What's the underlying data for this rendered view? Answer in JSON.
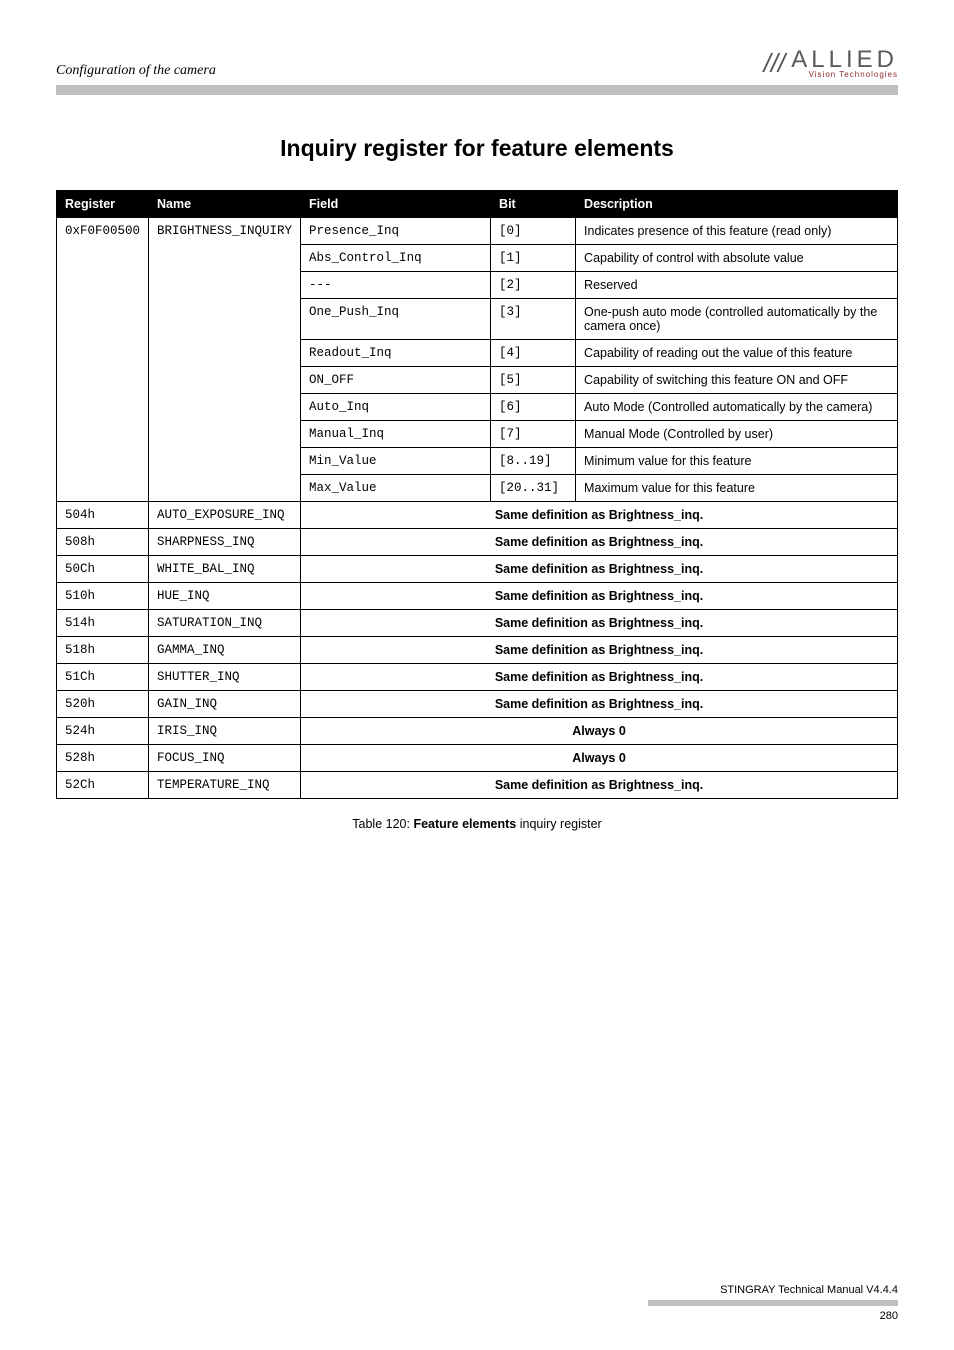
{
  "header": {
    "left": "Configuration of the camera",
    "logo_text": "ALLIED",
    "logo_sub": "Vision Technologies"
  },
  "section_title": "Inquiry register for feature elements",
  "columns": [
    "Register",
    "Name",
    "Field",
    "Bit",
    "Description"
  ],
  "brightness": {
    "register": "0xF0F00500",
    "name": "BRIGHTNESS_INQUIRY",
    "rows": [
      {
        "field": "Presence_Inq",
        "bit": "[0]",
        "desc": "Indicates presence of this feature (read only)"
      },
      {
        "field": "Abs_Control_Inq",
        "bit": "[1]",
        "desc": "Capability of control with absolute value"
      },
      {
        "field": "---",
        "bit": "[2]",
        "desc": "Reserved"
      },
      {
        "field": "One_Push_Inq",
        "bit": "[3]",
        "desc": "One-push auto mode (controlled automatically by the camera once)"
      },
      {
        "field": "Readout_Inq",
        "bit": "[4]",
        "desc": "Capability of reading out the value of this feature"
      },
      {
        "field": "ON_OFF",
        "bit": "[5]",
        "desc": "Capability of switching this feature ON and OFF"
      },
      {
        "field": "Auto_Inq",
        "bit": "[6]",
        "desc": "Auto Mode (Controlled automatically by the camera)"
      },
      {
        "field": "Manual_Inq",
        "bit": "[7]",
        "desc": "Manual Mode (Controlled by user)"
      },
      {
        "field": "Min_Value",
        "bit": "[8..19]",
        "desc": "Minimum value for this feature"
      },
      {
        "field": "Max_Value",
        "bit": "[20..31]",
        "desc": "Maximum value for this feature"
      }
    ]
  },
  "followup": [
    {
      "reg": "504h",
      "name": "AUTO_EXPOSURE_INQ",
      "span": "Same definition as Brightness_inq."
    },
    {
      "reg": "508h",
      "name": "SHARPNESS_INQ",
      "span": "Same definition as Brightness_inq."
    },
    {
      "reg": "50Ch",
      "name": "WHITE_BAL_INQ",
      "span": "Same definition as Brightness_inq."
    },
    {
      "reg": "510h",
      "name": "HUE_INQ",
      "span": "Same definition as Brightness_inq."
    },
    {
      "reg": "514h",
      "name": "SATURATION_INQ",
      "span": "Same definition as Brightness_inq."
    },
    {
      "reg": "518h",
      "name": "GAMMA_INQ",
      "span": "Same definition as Brightness_inq."
    },
    {
      "reg": "51Ch",
      "name": "SHUTTER_INQ",
      "span": "Same definition as Brightness_inq."
    },
    {
      "reg": "520h",
      "name": "GAIN_INQ",
      "span": "Same definition as Brightness_inq."
    },
    {
      "reg": "524h",
      "name": "IRIS_INQ",
      "span": "Always 0"
    },
    {
      "reg": "528h",
      "name": "FOCUS_INQ",
      "span": "Always 0"
    },
    {
      "reg": "52Ch",
      "name": "TEMPERATURE_INQ",
      "span": "Same definition as Brightness_inq."
    }
  ],
  "caption": {
    "pre": "Table 120: ",
    "bold": "Feature elements",
    "post": " inquiry register"
  },
  "footer": {
    "text": "STINGRAY Technical Manual V4.4.4",
    "page": "280"
  }
}
